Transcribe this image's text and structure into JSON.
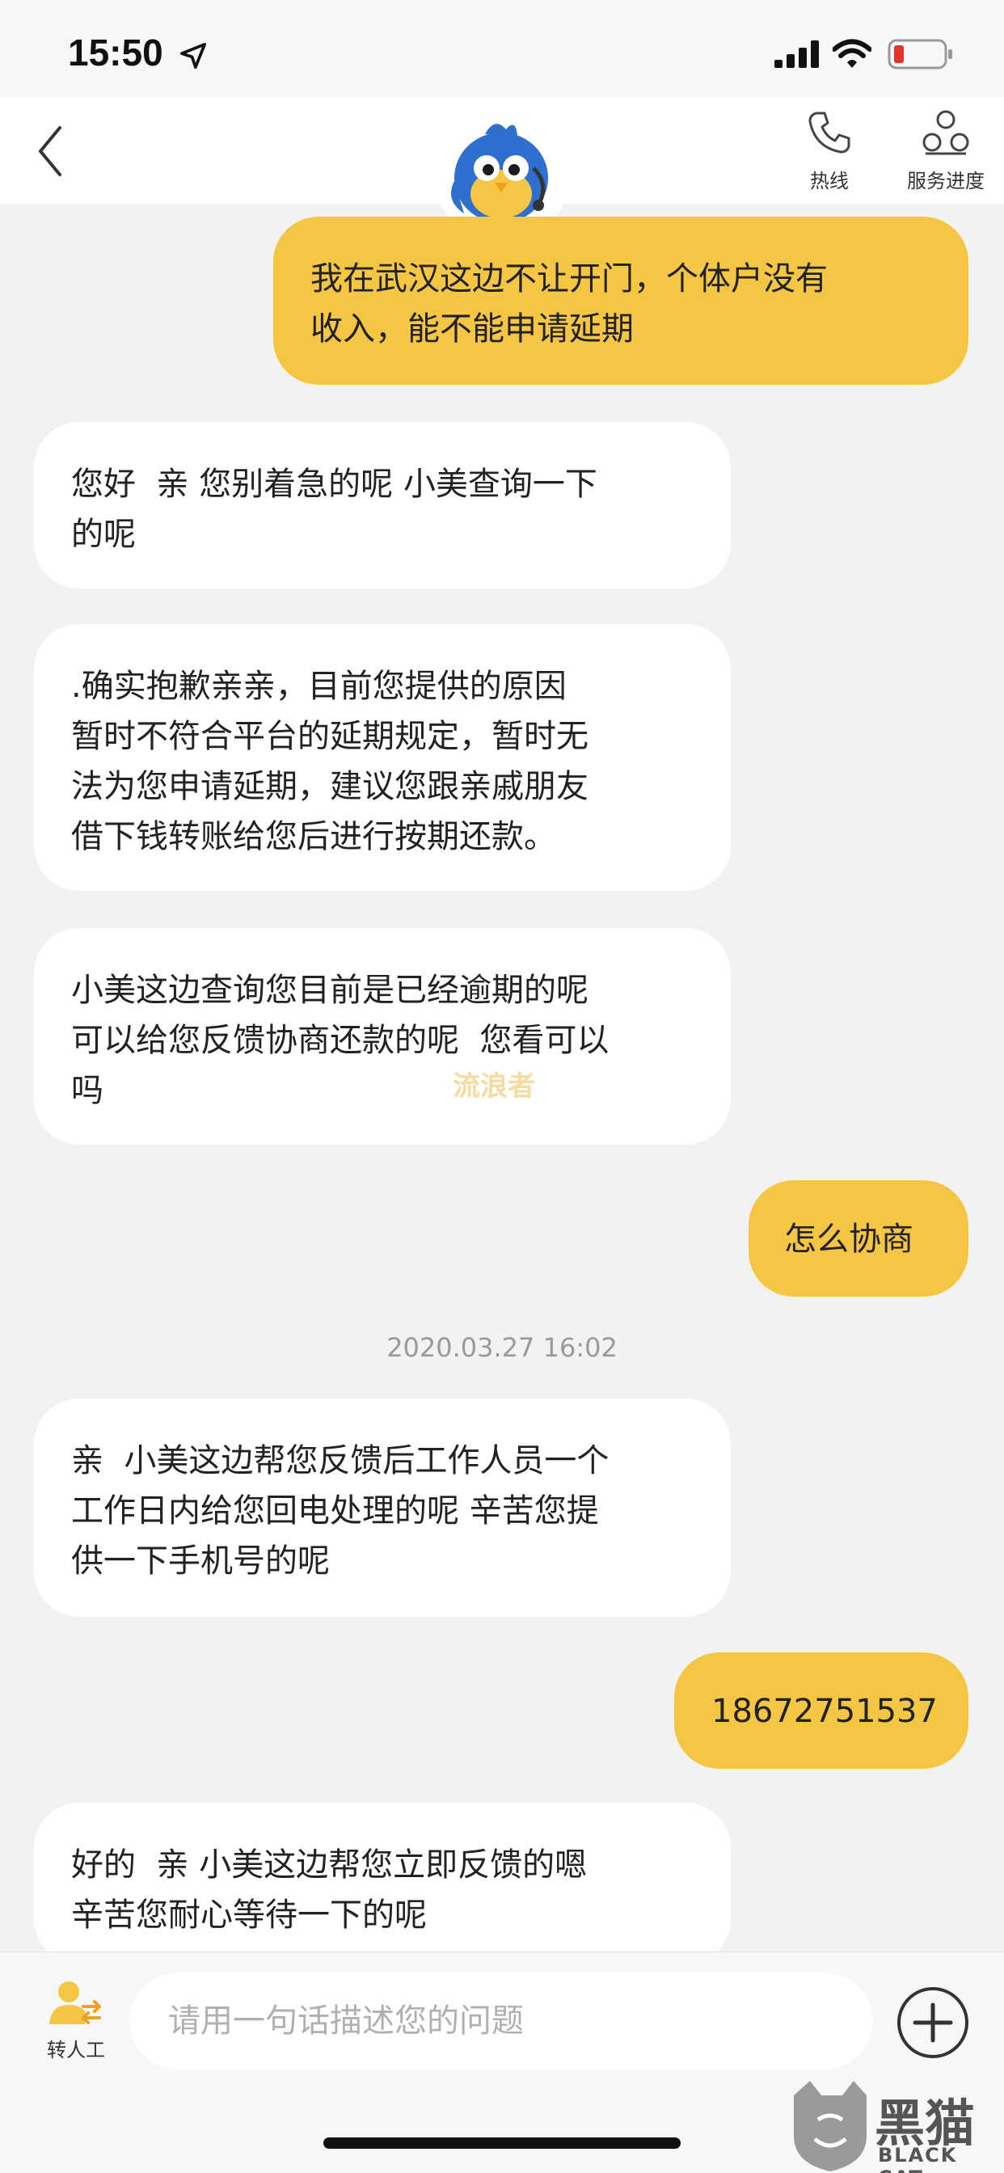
{
  "status_bar": {
    "time": "15:50"
  },
  "nav": {
    "hotline_label": "热线",
    "progress_label": "服务进度"
  },
  "messages": [
    {
      "side": "right",
      "text": "我在武汉这边不让开门，个体户没有\n收入，能不能申请延期"
    },
    {
      "side": "left",
      "text": "您好  亲 您别着急的呢 小美查询一下\n的呢"
    },
    {
      "side": "left",
      "text": ".确实抱歉亲亲，目前您提供的原因\n暂时不符合平台的延期规定，暂时无\n法为您申请延期，建议您跟亲戚朋友\n借下钱转账给您后进行按期还款。"
    },
    {
      "side": "left",
      "text": "小美这边查询您目前是已经逾期的呢\n可以给您反馈协商还款的呢  您看可以\n吗"
    },
    {
      "side": "right",
      "text": "怎么协商"
    },
    {
      "side": "left",
      "text": "亲  小美这边帮您反馈后工作人员一个\n工作日内给您回电处理的呢 辛苦您提\n供一下手机号的呢"
    },
    {
      "side": "right",
      "text": "18672751537"
    },
    {
      "side": "left",
      "text": "好的  亲 小美这边帮您立即反馈的嗯\n辛苦您耐心等待一下的呢"
    }
  ],
  "watermark": "流浪者",
  "timestamp": "2020.03.27 16:02",
  "bottom": {
    "agent_label": "转人工",
    "input_placeholder": "请用一句话描述您的问题",
    "input_value": ""
  },
  "logo": {
    "text": "黑猫",
    "sub": "BLACK CAT"
  },
  "colors": {
    "accent": "#f5c544",
    "bubble_left": "#ffffff",
    "background": "#f2f2f2"
  }
}
